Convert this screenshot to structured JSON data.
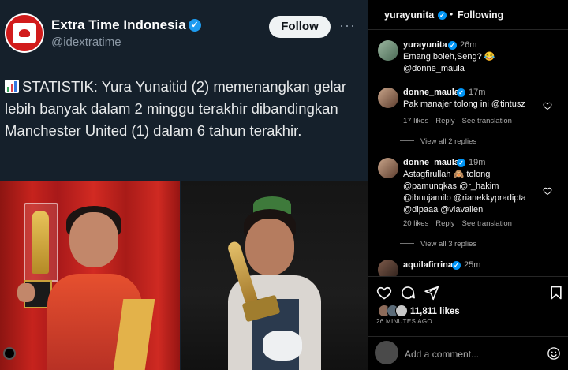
{
  "tweet": {
    "account_name": "Extra Time Indonesia",
    "handle": "@idextratime",
    "follow_label": "Follow",
    "more_label": "···",
    "verified_glyph": "✓",
    "text": "STATISTIK: Yura Yunaitid (2) memenangkan gelar lebih banyak dalam 2 minggu terakhir dibandingkan Manchester United (1) dalam 6 tahun terakhir.",
    "text_icon": "bar-chart-icon",
    "avatar_icon": "extra-time-logo",
    "brand_color": "#d11b1b",
    "link_color": "#1d9bf0"
  },
  "ig": {
    "header": {
      "username": "yurayunita",
      "separator": "•",
      "following_label": "Following"
    },
    "comments": [
      {
        "user": "yurayunita",
        "time": "26m",
        "lines": [
          "Emang boleh,Seng? 😂",
          "@donne_maula"
        ],
        "likes": "",
        "reply": "",
        "translate": "",
        "view_replies": ""
      },
      {
        "user": "donne_maula",
        "time": "17m",
        "lines": [
          "Pak manajer tolong ini @tintusz"
        ],
        "likes": "17 likes",
        "reply": "Reply",
        "translate": "See translation",
        "view_replies": "View all 2 replies"
      },
      {
        "user": "donne_maula",
        "time": "19m",
        "lines": [
          "Astagfirullah 🙈 tolong",
          "@pamunqkas @r_hakim",
          "@ibnujamilo @rianekkypradipta",
          "@dipaaa @viavallen"
        ],
        "likes": "20 likes",
        "reply": "Reply",
        "translate": "See translation",
        "view_replies": "View all 3 replies"
      },
      {
        "user": "aquilafirrina",
        "time": "25m",
        "lines": [],
        "likes": "",
        "reply": "",
        "translate": "",
        "view_replies": ""
      }
    ],
    "likes": "11,811 likes",
    "time_ago": "26 MINUTES AGO",
    "add_comment_placeholder": "Add a comment...",
    "verified_color": "#0095f6",
    "icons": [
      "heart-icon",
      "comment-icon",
      "share-icon",
      "bookmark-icon",
      "emoji-icon"
    ]
  }
}
